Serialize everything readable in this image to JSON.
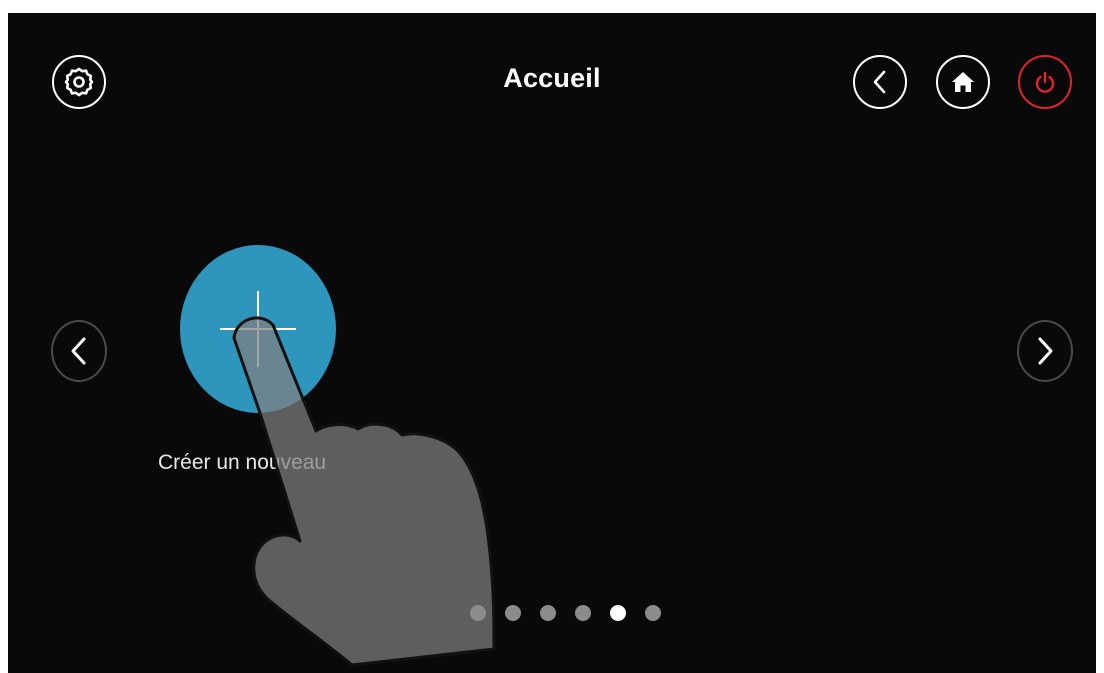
{
  "header": {
    "title": "Accueil",
    "settings_icon": "gear-icon",
    "back_icon": "chevron-left-icon",
    "home_icon": "home-icon",
    "power_icon": "power-icon"
  },
  "main": {
    "create_button_icon": "plus-icon",
    "create_label": "Créer un nouveau",
    "prev_icon": "chevron-left-icon",
    "next_icon": "chevron-right-icon"
  },
  "pagination": {
    "total_pages": 6,
    "current_page": 5
  },
  "colors": {
    "background": "#0a0909",
    "accent": "#2e95bd",
    "power": "#e0242a",
    "dot_inactive": "#8c8c8c",
    "dot_active": "#ffffff"
  },
  "overlay": {
    "icon": "hand-pointer-icon"
  }
}
